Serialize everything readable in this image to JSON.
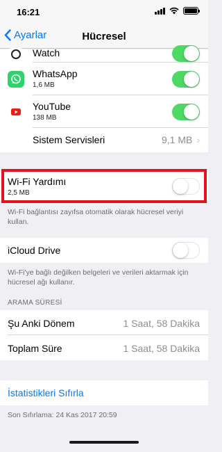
{
  "status": {
    "time": "16:21"
  },
  "nav": {
    "back_label": "Ayarlar",
    "title": "Hücresel"
  },
  "apps": [
    {
      "name": "Watch",
      "size": "",
      "enabled": true,
      "icon": "watch-icon"
    },
    {
      "name": "WhatsApp",
      "size": "1,6 MB",
      "enabled": true,
      "icon": "whatsapp-icon"
    },
    {
      "name": "YouTube",
      "size": "138 MB",
      "enabled": true,
      "icon": "youtube-icon"
    }
  ],
  "system_services": {
    "label": "Sistem Servisleri",
    "value": "9,1 MB"
  },
  "wifi_assist": {
    "label": "Wi-Fi Yardımı",
    "size": "2,5 MB",
    "enabled": false,
    "footer": "Wi-Fi bağlantısı zayıfsa otomatik olarak hücresel veriyi kullan."
  },
  "icloud_drive": {
    "label": "iCloud Drive",
    "enabled": false,
    "footer": "Wi-Fi'ye bağlı değilken belgeleri ve verileri aktarmak için hücresel ağı kullanır."
  },
  "call_time": {
    "header": "ARAMA SÜRESİ",
    "current_label": "Şu Anki Dönem",
    "current_value": "1 Saat, 58 Dakika",
    "total_label": "Toplam Süre",
    "total_value": "1 Saat, 58 Dakika"
  },
  "reset": {
    "label": "İstatistikleri Sıfırla",
    "last_reset": "Son Sıfırlama: 24 Kas 2017 20:59"
  },
  "colors": {
    "accent": "#007aff",
    "toggle_on": "#4cd964",
    "highlight": "#e0131f"
  }
}
